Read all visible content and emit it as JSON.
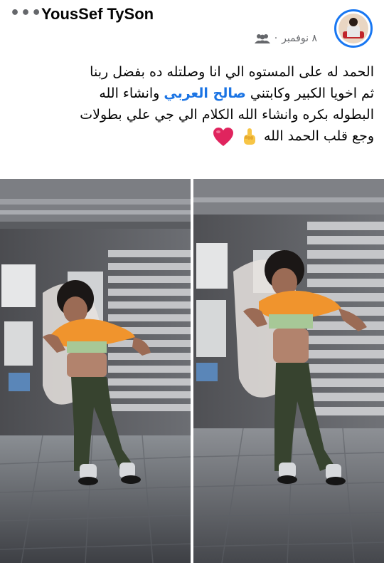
{
  "post": {
    "author": "YousSef TySon",
    "more_label": "•••",
    "date": "٨ نوفمبر",
    "separator": "·",
    "audience_icon": "friends-icon",
    "text_lines": [
      "الحمد له على المستوه الي انا وصلتله ده بفضل ربنا",
      "ثم اخويا الكبير وكابتني",
      "وانشاء الله",
      "البطوله بكره وانشاء الله الكلام الي جي علي بطولات",
      "وجع قلب الحمد الله"
    ],
    "mention": "صالح العربي",
    "emojis": [
      "pointing-up-emoji",
      "red-heart-emoji"
    ]
  },
  "photos": [
    {
      "name": "post-photo-1"
    },
    {
      "name": "post-photo-2"
    }
  ],
  "colors": {
    "accent": "#1877f2",
    "mention": "#1b74e4",
    "meta": "#65676b",
    "heart": "#e0245e"
  }
}
